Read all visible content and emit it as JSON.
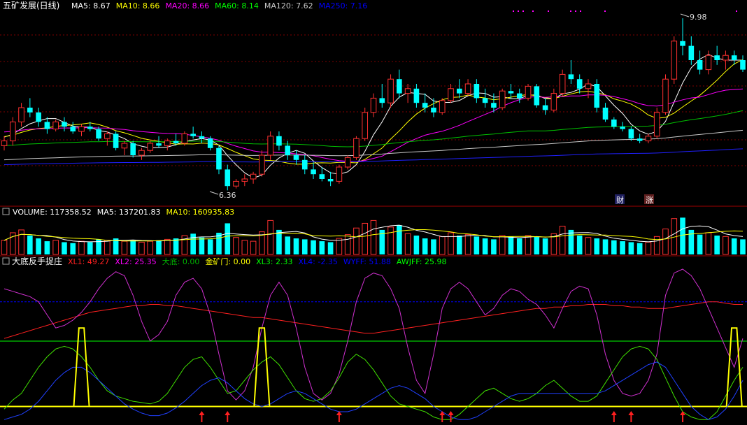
{
  "price_panel": {
    "stock": "五矿发展(日线)",
    "ma_labels": [
      {
        "text": "MA5: 8.67",
        "color": "#ffffff"
      },
      {
        "text": "MA10: 8.66",
        "color": "#ffff00"
      },
      {
        "text": "MA20: 8.66",
        "color": "#ff00ff"
      },
      {
        "text": "MA60: 8.14",
        "color": "#00ff00"
      },
      {
        "text": "MA120: 7.62",
        "color": "#c8c8c8"
      },
      {
        "text": "MA250: 7.16",
        "color": "#0000ff"
      }
    ],
    "high_label": "9.98",
    "low_label": "6.36",
    "badges": [
      "财",
      "涨"
    ]
  },
  "volume_panel": {
    "labels": [
      {
        "text": "VOLUME: 117358.52",
        "color": "#ffffff"
      },
      {
        "text": "MA5: 137201.83",
        "color": "#ffffff"
      },
      {
        "text": "MA10: 160935.83",
        "color": "#ffff00"
      }
    ]
  },
  "indicator_panel": {
    "title": "大底反手捉庄",
    "labels": [
      {
        "text": "XL1: 49.27",
        "color": "#ff2020"
      },
      {
        "text": "XL2: 25.35",
        "color": "#ff00ff"
      },
      {
        "text": "大底: 0.00",
        "color": "#00b000"
      },
      {
        "text": "金矿门: 0.00",
        "color": "#ffff00"
      },
      {
        "text": "XL3: 2.33",
        "color": "#00ff00"
      },
      {
        "text": "XL4: -2.35",
        "color": "#0000ff"
      },
      {
        "text": "WYFF: 51.88",
        "color": "#0000ff"
      },
      {
        "text": "AWJFF: 25.98",
        "color": "#00ff00"
      }
    ]
  },
  "colors": {
    "up": "#ff3030",
    "down": "#00ffff",
    "grid": "#800000",
    "background": "#000000"
  },
  "chart_data": [
    {
      "type": "candlestick",
      "name": "price",
      "ylim": [
        6.1,
        10.1
      ],
      "annotations": [
        {
          "text": "9.98",
          "value": 9.98
        },
        {
          "text": "6.36",
          "value": 6.36
        }
      ],
      "ohlc": [
        [
          7.3,
          7.5,
          7.2,
          7.4
        ],
        [
          7.4,
          7.9,
          7.3,
          7.8
        ],
        [
          7.8,
          8.2,
          7.7,
          8.1
        ],
        [
          8.1,
          8.3,
          7.9,
          8.0
        ],
        [
          8.0,
          8.1,
          7.7,
          7.8
        ],
        [
          7.8,
          7.9,
          7.55,
          7.65
        ],
        [
          7.65,
          7.85,
          7.6,
          7.8
        ],
        [
          7.8,
          7.9,
          7.6,
          7.7
        ],
        [
          7.7,
          7.8,
          7.55,
          7.6
        ],
        [
          7.6,
          7.75,
          7.5,
          7.7
        ],
        [
          7.7,
          7.8,
          7.6,
          7.65
        ],
        [
          7.65,
          7.7,
          7.4,
          7.45
        ],
        [
          7.45,
          7.6,
          7.3,
          7.55
        ],
        [
          7.55,
          7.6,
          7.2,
          7.25
        ],
        [
          7.25,
          7.4,
          7.1,
          7.35
        ],
        [
          7.35,
          7.4,
          7.05,
          7.1
        ],
        [
          7.1,
          7.25,
          7.0,
          7.2
        ],
        [
          7.2,
          7.4,
          7.15,
          7.35
        ],
        [
          7.35,
          7.5,
          7.25,
          7.3
        ],
        [
          7.3,
          7.45,
          7.2,
          7.4
        ],
        [
          7.4,
          7.55,
          7.3,
          7.35
        ],
        [
          7.35,
          7.6,
          7.3,
          7.55
        ],
        [
          7.55,
          7.7,
          7.45,
          7.5
        ],
        [
          7.5,
          7.6,
          7.35,
          7.45
        ],
        [
          7.45,
          7.5,
          7.2,
          7.25
        ],
        [
          7.25,
          7.3,
          6.7,
          6.8
        ],
        [
          6.8,
          6.9,
          6.36,
          6.45
        ],
        [
          6.45,
          6.6,
          6.4,
          6.55
        ],
        [
          6.55,
          6.7,
          6.45,
          6.6
        ],
        [
          6.6,
          6.75,
          6.5,
          6.7
        ],
        [
          6.7,
          7.2,
          6.65,
          7.1
        ],
        [
          7.1,
          7.6,
          7.0,
          7.5
        ],
        [
          7.5,
          7.6,
          7.2,
          7.3
        ],
        [
          7.3,
          7.4,
          7.0,
          7.1
        ],
        [
          7.1,
          7.2,
          6.9,
          7.0
        ],
        [
          7.0,
          7.1,
          6.7,
          6.8
        ],
        [
          6.8,
          6.95,
          6.6,
          6.7
        ],
        [
          6.7,
          6.85,
          6.55,
          6.6
        ],
        [
          6.6,
          6.75,
          6.45,
          6.55
        ],
        [
          6.55,
          6.9,
          6.5,
          6.85
        ],
        [
          6.85,
          7.1,
          6.8,
          7.05
        ],
        [
          7.05,
          7.5,
          7.0,
          7.45
        ],
        [
          7.45,
          8.1,
          7.4,
          8.0
        ],
        [
          8.0,
          8.4,
          7.9,
          8.3
        ],
        [
          8.3,
          8.6,
          8.1,
          8.2
        ],
        [
          8.2,
          8.8,
          8.1,
          8.7
        ],
        [
          8.7,
          8.9,
          8.3,
          8.4
        ],
        [
          8.4,
          8.6,
          8.2,
          8.5
        ],
        [
          8.5,
          8.6,
          8.1,
          8.2
        ],
        [
          8.2,
          8.4,
          8.0,
          8.1
        ],
        [
          8.1,
          8.3,
          7.9,
          8.0
        ],
        [
          8.0,
          8.3,
          7.95,
          8.25
        ],
        [
          8.25,
          8.6,
          8.2,
          8.5
        ],
        [
          8.5,
          8.7,
          8.3,
          8.4
        ],
        [
          8.4,
          8.7,
          8.35,
          8.6
        ],
        [
          8.6,
          8.7,
          8.2,
          8.3
        ],
        [
          8.3,
          8.5,
          8.1,
          8.2
        ],
        [
          8.2,
          8.4,
          8.0,
          8.1
        ],
        [
          8.1,
          8.5,
          8.05,
          8.45
        ],
        [
          8.45,
          8.6,
          8.3,
          8.4
        ],
        [
          8.4,
          8.5,
          8.2,
          8.3
        ],
        [
          8.3,
          8.6,
          8.25,
          8.55
        ],
        [
          8.55,
          8.6,
          8.1,
          8.15
        ],
        [
          8.15,
          8.3,
          7.95,
          8.05
        ],
        [
          8.05,
          8.5,
          8.0,
          8.4
        ],
        [
          8.4,
          8.9,
          8.35,
          8.8
        ],
        [
          8.8,
          9.1,
          8.6,
          8.7
        ],
        [
          8.7,
          8.8,
          8.4,
          8.5
        ],
        [
          8.5,
          8.7,
          8.3,
          8.6
        ],
        [
          8.6,
          8.7,
          8.0,
          8.1
        ],
        [
          8.1,
          8.2,
          7.8,
          7.85
        ],
        [
          7.85,
          7.9,
          7.65,
          7.7
        ],
        [
          7.7,
          7.8,
          7.6,
          7.65
        ],
        [
          7.65,
          7.7,
          7.4,
          7.45
        ],
        [
          7.45,
          7.55,
          7.35,
          7.4
        ],
        [
          7.4,
          7.55,
          7.35,
          7.5
        ],
        [
          7.5,
          8.1,
          7.45,
          8.0
        ],
        [
          8.0,
          8.8,
          7.95,
          8.7
        ],
        [
          8.7,
          9.6,
          8.6,
          9.5
        ],
        [
          9.5,
          9.98,
          9.2,
          9.4
        ],
        [
          9.4,
          9.6,
          9.0,
          9.1
        ],
        [
          9.1,
          9.3,
          8.8,
          8.9
        ],
        [
          8.9,
          9.3,
          8.8,
          9.2
        ],
        [
          9.2,
          9.4,
          9.0,
          9.1
        ],
        [
          9.1,
          9.3,
          8.9,
          9.2
        ],
        [
          9.2,
          9.3,
          9.0,
          9.1
        ],
        [
          9.1,
          9.2,
          8.85,
          8.9
        ]
      ],
      "ma_series": [
        {
          "name": "MA5",
          "last": 8.67
        },
        {
          "name": "MA10",
          "last": 8.66
        },
        {
          "name": "MA20",
          "last": 8.66
        },
        {
          "name": "MA60",
          "last": 8.14
        },
        {
          "name": "MA120",
          "last": 7.62
        },
        {
          "name": "MA250",
          "last": 7.16
        }
      ]
    },
    {
      "type": "bar",
      "name": "volume",
      "ylim": [
        0,
        400000
      ],
      "values": [
        150000,
        230000,
        260000,
        200000,
        170000,
        140000,
        150000,
        130000,
        120000,
        140000,
        130000,
        160000,
        150000,
        170000,
        140000,
        150000,
        130000,
        140000,
        150000,
        160000,
        170000,
        200000,
        220000,
        180000,
        160000,
        230000,
        330000,
        180000,
        150000,
        140000,
        240000,
        360000,
        260000,
        190000,
        170000,
        160000,
        150000,
        140000,
        130000,
        170000,
        210000,
        280000,
        330000,
        360000,
        260000,
        290000,
        310000,
        220000,
        200000,
        170000,
        160000,
        190000,
        230000,
        200000,
        210000,
        190000,
        170000,
        160000,
        200000,
        190000,
        170000,
        200000,
        190000,
        170000,
        220000,
        300000,
        260000,
        200000,
        180000,
        170000,
        160000,
        150000,
        140000,
        130000,
        120000,
        130000,
        190000,
        270000,
        380000,
        390000,
        260000,
        210000,
        230000,
        200000,
        190000,
        170000,
        160000
      ],
      "ma5_last": 137201.83,
      "ma10_last": 160935.83
    },
    {
      "type": "line",
      "name": "大底反手捉庄",
      "ylim": [
        -12,
        105
      ],
      "levels": [
        {
          "value": 80,
          "color": "#0000ff"
        },
        {
          "value": 50,
          "color": "#00ff00"
        },
        {
          "value": 0,
          "color": "#ffff00"
        }
      ],
      "series": [
        {
          "name": "XL1",
          "values": [
            52,
            54,
            56,
            58,
            60,
            62,
            64,
            66,
            68,
            70,
            72,
            73,
            74,
            75,
            76,
            77,
            77,
            78,
            78,
            77,
            77,
            76,
            75,
            74,
            73,
            72,
            71,
            70,
            69,
            68,
            68,
            67,
            66,
            65,
            64,
            63,
            62,
            61,
            60,
            59,
            58,
            57,
            56,
            56,
            57,
            58,
            59,
            60,
            61,
            62,
            63,
            64,
            65,
            66,
            67,
            68,
            69,
            70,
            71,
            72,
            73,
            74,
            75,
            75,
            76,
            76,
            77,
            77,
            78,
            78,
            78,
            77,
            77,
            76,
            76,
            75,
            75,
            75,
            76,
            77,
            78,
            79,
            80,
            80,
            79,
            78,
            78
          ]
        },
        {
          "name": "XL2",
          "values": [
            90,
            88,
            86,
            84,
            80,
            70,
            60,
            62,
            66,
            72,
            80,
            90,
            98,
            103,
            100,
            85,
            65,
            50,
            55,
            65,
            85,
            95,
            98,
            90,
            70,
            40,
            12,
            5,
            12,
            30,
            60,
            85,
            95,
            85,
            60,
            30,
            10,
            5,
            10,
            25,
            50,
            80,
            98,
            102,
            100,
            90,
            75,
            45,
            20,
            10,
            40,
            75,
            90,
            95,
            90,
            80,
            70,
            75,
            85,
            90,
            88,
            82,
            78,
            70,
            60,
            75,
            88,
            92,
            90,
            70,
            40,
            20,
            10,
            8,
            10,
            20,
            40,
            85,
            102,
            105,
            100,
            90,
            75,
            60,
            45,
            30,
            52
          ]
        },
        {
          "name": "AWJFF",
          "values": [
            -2,
            5,
            10,
            20,
            30,
            38,
            44,
            46,
            44,
            38,
            30,
            20,
            12,
            8,
            6,
            4,
            3,
            2,
            4,
            10,
            20,
            30,
            36,
            38,
            30,
            20,
            10,
            12,
            20,
            28,
            34,
            38,
            32,
            22,
            12,
            6,
            4,
            6,
            12,
            22,
            34,
            40,
            36,
            28,
            18,
            8,
            2,
            0,
            -2,
            -4,
            -8,
            -10,
            -10,
            -6,
            0,
            6,
            12,
            14,
            10,
            6,
            4,
            6,
            10,
            16,
            20,
            14,
            8,
            4,
            4,
            8,
            18,
            28,
            38,
            44,
            46,
            44,
            36,
            22,
            8,
            -4,
            -8,
            -10,
            -10,
            -4,
            8,
            20,
            30
          ]
        },
        {
          "name": "WYFF",
          "values": [
            -10,
            -8,
            -6,
            -2,
            4,
            12,
            20,
            26,
            30,
            30,
            26,
            20,
            14,
            8,
            2,
            -2,
            -5,
            -7,
            -7,
            -5,
            -1,
            4,
            10,
            16,
            20,
            22,
            18,
            12,
            6,
            2,
            0,
            2,
            6,
            10,
            12,
            10,
            6,
            2,
            -2,
            -4,
            -4,
            -2,
            2,
            6,
            10,
            14,
            16,
            14,
            10,
            6,
            0,
            -4,
            -8,
            -10,
            -10,
            -8,
            -4,
            0,
            4,
            8,
            10,
            10,
            10,
            10,
            10,
            10,
            10,
            10,
            10,
            10,
            12,
            16,
            20,
            24,
            28,
            32,
            34,
            30,
            20,
            10,
            0,
            -6,
            -10,
            -8,
            -2,
            8,
            20
          ]
        },
        {
          "name": "金矿门",
          "values": [
            0,
            0,
            0,
            0,
            0,
            0,
            0,
            0,
            0,
            0,
            0,
            0,
            0,
            0,
            0,
            0,
            0,
            0,
            0,
            0,
            0,
            0,
            0,
            0,
            0,
            0,
            0,
            0,
            0,
            0,
            0,
            0,
            0,
            0,
            0,
            0,
            0,
            0,
            0,
            0,
            0,
            0,
            0,
            0,
            0,
            0,
            0,
            0,
            0,
            0,
            0,
            0,
            0,
            0,
            0,
            0,
            0,
            0,
            0,
            0,
            0,
            0,
            0,
            0,
            0,
            0,
            0,
            0,
            0,
            0,
            0,
            0,
            0,
            0,
            0,
            0,
            0,
            0,
            0,
            0,
            0,
            0,
            0,
            0,
            0,
            0,
            0
          ]
        }
      ],
      "spikes": [
        {
          "index": 9,
          "value": 60
        },
        {
          "index": 30,
          "value": 60
        },
        {
          "index": 85,
          "value": 60
        }
      ],
      "buy_arrows": [
        23,
        26,
        39,
        51,
        52,
        71,
        73,
        79
      ]
    }
  ]
}
